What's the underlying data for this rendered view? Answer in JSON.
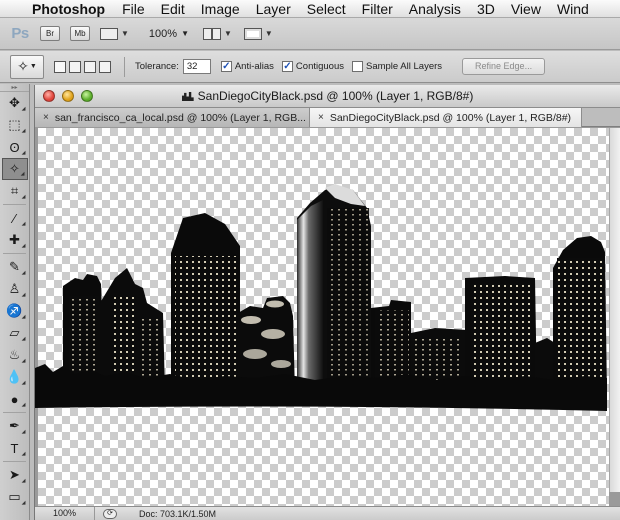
{
  "menubar": {
    "app_name": "Photoshop",
    "items": [
      "File",
      "Edit",
      "Image",
      "Layer",
      "Select",
      "Filter",
      "Analysis",
      "3D",
      "View",
      "Wind"
    ]
  },
  "appbar": {
    "logo": "Ps",
    "bridge_label": "Br",
    "minibridge_label": "Mb",
    "zoom": "100%"
  },
  "options": {
    "tolerance_label": "Tolerance:",
    "tolerance_value": "32",
    "anti_alias_label": "Anti-alias",
    "anti_alias_checked": true,
    "contiguous_label": "Contiguous",
    "contiguous_checked": true,
    "sample_all_label": "Sample All Layers",
    "sample_all_checked": false,
    "refine_edge_label": "Refine Edge..."
  },
  "document": {
    "title": "SanDiegoCityBlack.psd @ 100% (Layer 1, RGB/8#)",
    "tabs": [
      {
        "label": "san_francisco_ca_local.psd @ 100% (Layer 1, RGB...",
        "active": false
      },
      {
        "label": "SanDiegoCityBlack.psd @ 100% (Layer 1, RGB/8#)",
        "active": true
      }
    ],
    "tab_close": "×"
  },
  "status": {
    "zoom": "100%",
    "doc_size": "Doc: 703.1K/1.50M"
  },
  "tools": [
    {
      "name": "move-tool-icon",
      "glyph": "✥"
    },
    {
      "name": "marquee-tool-icon",
      "glyph": "⬚"
    },
    {
      "name": "lasso-tool-icon",
      "glyph": "ʘ"
    },
    {
      "name": "magic-wand-tool-icon",
      "glyph": "✧"
    },
    {
      "name": "crop-tool-icon",
      "glyph": "⌗"
    },
    {
      "name": "eyedropper-tool-icon",
      "glyph": "⁄"
    },
    {
      "name": "healing-brush-tool-icon",
      "glyph": "✚"
    },
    {
      "name": "brush-tool-icon",
      "glyph": "✎"
    },
    {
      "name": "clone-stamp-tool-icon",
      "glyph": "♙"
    },
    {
      "name": "history-brush-tool-icon",
      "glyph": "♐"
    },
    {
      "name": "eraser-tool-icon",
      "glyph": "▱"
    },
    {
      "name": "paint-bucket-tool-icon",
      "glyph": "♨"
    },
    {
      "name": "blur-tool-icon",
      "glyph": "💧"
    },
    {
      "name": "dodge-tool-icon",
      "glyph": "●"
    },
    {
      "name": "pen-tool-icon",
      "glyph": "✒"
    },
    {
      "name": "type-tool-icon",
      "glyph": "T"
    },
    {
      "name": "path-selection-tool-icon",
      "glyph": "➤"
    },
    {
      "name": "rectangle-tool-icon",
      "glyph": "▭"
    }
  ],
  "colors": {
    "checker_dark": "#cccccc",
    "checker_light": "#ffffff",
    "skyline": "#0a0a0a",
    "window_lights": "#fff6d8"
  }
}
